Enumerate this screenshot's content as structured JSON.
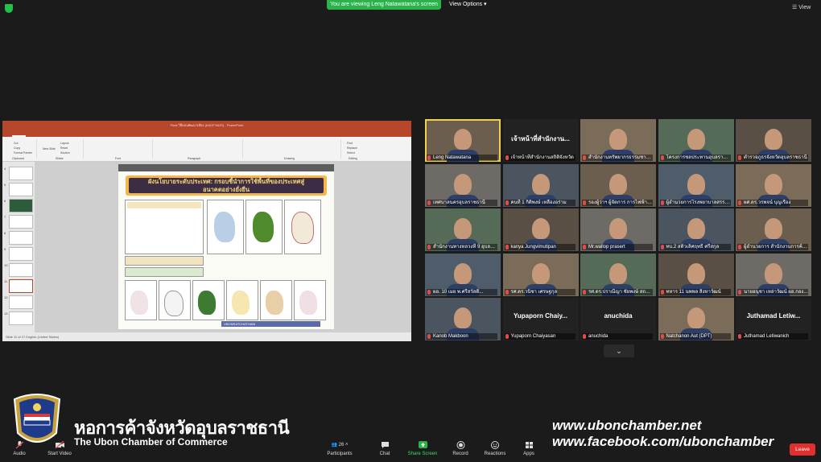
{
  "top_bar": {
    "viewing_banner": "You are viewing Leng Natawatana's screen",
    "view_options": "View Options ▾",
    "view_button": "☰ View"
  },
  "ppt": {
    "title": "Final วิธีแผนพัฒนาเมือง (แบบร่างแรก) - PowerPoint",
    "tabs": [
      "File",
      "Home",
      "Insert",
      "Design",
      "Transitions",
      "Animations",
      "Slide Show",
      "Review",
      "View",
      "Recording",
      "Help",
      "Tell me what you want to do"
    ],
    "ribbon": {
      "cut": "Cut",
      "copy": "Copy",
      "format_painter": "Format Painter",
      "new_slide": "New Slide",
      "layout": "Layout",
      "reset": "Reset",
      "section": "Section",
      "clipboard": "Clipboard",
      "slides": "Slides",
      "font": "Font",
      "paragraph": "Paragraph",
      "drawing": "Drawing",
      "editing": "Editing",
      "find": "Find",
      "replace": "Replace",
      "select": "Select"
    },
    "slide_numbers": [
      "4",
      "5",
      "6",
      "7",
      "8",
      "9",
      "10",
      "11",
      "12",
      "13"
    ],
    "slide": {
      "title_line1": "ผังนโยบายระดับประเทศ: กรอบชี้นำการใช้พื้นที่ของประเทศสู่",
      "title_line2": "อนาคตอย่างยั่งยืน",
      "footer": "UBONRATCHATHANI"
    },
    "status": "Slide 11 of 27   English (United States)"
  },
  "participants": [
    {
      "name": "Leng Natawatana",
      "kind": "video",
      "selected": true
    },
    {
      "name": "เจ้าหน้าที่สำนักงานสถิติจังหวัด",
      "kind": "name",
      "big": "เจ้าหน้าที่สำนักงาน..."
    },
    {
      "name": "สำนักงานทรัพยากรธรรมชาติ...",
      "kind": "video"
    },
    {
      "name": "โครงการชลประทานอุบลราชธานี",
      "kind": "video"
    },
    {
      "name": "ตำรวจภูธรจังหวัดอุบลราชธานี",
      "kind": "video"
    },
    {
      "name": "เทศบาลนครอุบลราชธานี",
      "kind": "video"
    },
    {
      "name": "คนที่ 1 กิติพงษ์ เหลืองอร่าม",
      "kind": "video"
    },
    {
      "name": "รองผู้ว่าฯ ผู้จัดการ การไฟฟ้าส่วน...",
      "kind": "video"
    },
    {
      "name": "ผู้อำนวยการโรงพยาบาลสรรพสิทธิ...",
      "kind": "video"
    },
    {
      "name": "ผศ.ดร.วรพจน์ บุญเรือง",
      "kind": "video"
    },
    {
      "name": "สำนักงานทางหลวงที่ 9 อุบลราชธานี",
      "kind": "video"
    },
    {
      "name": "kanya Jungvimutipan",
      "kind": "video"
    },
    {
      "name": "Mr.wallop prasert",
      "kind": "video"
    },
    {
      "name": "ทบ.2 สติวเลิศฤทธิ์ ศรีสกุล",
      "kind": "video"
    },
    {
      "name": "ผู้อำนวยการ สำนักงานการค้า...",
      "kind": "video"
    },
    {
      "name": "ผอ. 10 เมย พ.ศรีสวัสดิ์...",
      "kind": "video"
    },
    {
      "name": "รศ.ดร.วนิชา เศรษฐกุล",
      "kind": "video"
    },
    {
      "name": "รศ.ดร.ปราณีญา ชัยพงษ์ สถาบัน...",
      "kind": "video"
    },
    {
      "name": "ทหาร 11 นพพล สิงหาวัฒน์",
      "kind": "video"
    },
    {
      "name": "นายอนุชา เหล่าวัฒน์ ผอ.กอง...",
      "kind": "video"
    },
    {
      "name": "Kanob Makboon",
      "kind": "video"
    },
    {
      "name": "Yupaporn Chaiyasan",
      "kind": "name",
      "big": "Yupaporn Chaiy..."
    },
    {
      "name": "anuchida",
      "kind": "name",
      "big": "anuchida"
    },
    {
      "name": "Natchanon Aut (DPT)",
      "kind": "video"
    },
    {
      "name": "Juthamad Letiwanich",
      "kind": "name",
      "big": "Juthamad Letiw..."
    }
  ],
  "overlay": {
    "chamber_th": "หอการค้าจังหวัดอุบลราชธานี",
    "chamber_en": "The Ubon Chamber of Commerce",
    "website": "www.ubonchamber.net",
    "facebook": "www.facebook.com/ubonchamber"
  },
  "toolbar": {
    "audio": "Audio",
    "start_video": "Start Video",
    "participants": "Participants",
    "participants_count": "26",
    "chat": "Chat",
    "share_screen": "Share Screen",
    "record": "Record",
    "reactions": "Reactions",
    "apps": "Apps",
    "leave": "Leave"
  },
  "colors": {
    "ppt_accent": "#b7472a",
    "share_green": "#2ab34a",
    "leave_red": "#e02f2f",
    "active_speaker": "#f1d14b"
  }
}
